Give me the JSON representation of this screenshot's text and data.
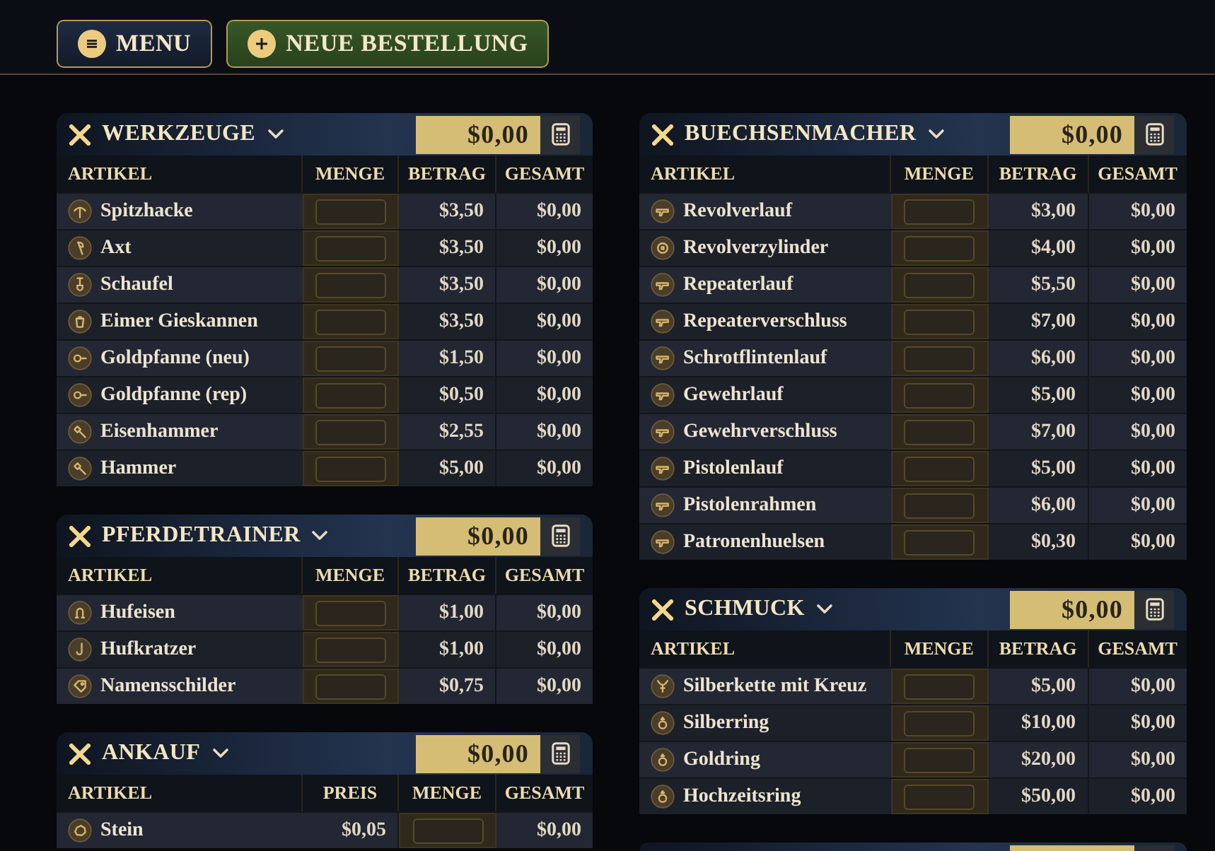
{
  "toolbar": {
    "buttons": [
      {
        "label": "MENU",
        "kind": "menu"
      },
      {
        "label": "NEUE BESTELLUNG",
        "kind": "new"
      }
    ]
  },
  "columns": [
    {
      "panels": [
        {
          "title": "WERKZEUGE",
          "expanded": true,
          "total": "$0,00",
          "columns": [
            {
              "label": "ARTIKEL",
              "kind": "item"
            },
            {
              "label": "MENGE",
              "kind": "quantity"
            },
            {
              "label": "BETRAG",
              "kind": "price"
            },
            {
              "label": "GESAMT",
              "kind": "total"
            }
          ],
          "rows": [
            {
              "item": "Spitzhacke",
              "price": "$3,50",
              "total": "$0,00"
            },
            {
              "item": "Axt",
              "price": "$3,50",
              "total": "$0,00"
            },
            {
              "item": "Schaufel",
              "price": "$3,50",
              "total": "$0,00"
            },
            {
              "item": "Eimer Gieskannen",
              "price": "$3,50",
              "total": "$0,00"
            },
            {
              "item": "Goldpfanne (neu)",
              "price": "$1,50",
              "total": "$0,00"
            },
            {
              "item": "Goldpfanne (rep)",
              "price": "$0,50",
              "total": "$0,00"
            },
            {
              "item": "Eisenhammer",
              "price": "$2,55",
              "total": "$0,00"
            },
            {
              "item": "Hammer",
              "price": "$5,00",
              "total": "$0,00"
            }
          ]
        },
        {
          "title": "PFERDETRAINER",
          "expanded": true,
          "total": "$0,00",
          "columns": [
            {
              "label": "ARTIKEL",
              "kind": "item"
            },
            {
              "label": "MENGE",
              "kind": "quantity"
            },
            {
              "label": "BETRAG",
              "kind": "price"
            },
            {
              "label": "GESAMT",
              "kind": "total"
            }
          ],
          "rows": [
            {
              "item": "Hufeisen",
              "price": "$1,00",
              "total": "$0,00"
            },
            {
              "item": "Hufkratzer",
              "price": "$1,00",
              "total": "$0,00"
            },
            {
              "item": "Namensschilder",
              "price": "$0,75",
              "total": "$0,00"
            }
          ]
        },
        {
          "title": "ANKAUF",
          "expanded": true,
          "total": "$0,00",
          "columns": [
            {
              "label": "ARTIKEL",
              "kind": "item"
            },
            {
              "label": "PREIS",
              "kind": "price"
            },
            {
              "label": "MENGE",
              "kind": "quantity"
            },
            {
              "label": "GESAMT",
              "kind": "total"
            }
          ],
          "rows": [
            {
              "item": "Stein",
              "price": "$0,05",
              "total": "$0,00"
            }
          ]
        }
      ]
    },
    {
      "panels": [
        {
          "title": "BUECHSENMACHER",
          "expanded": true,
          "total": "$0,00",
          "columns": [
            {
              "label": "ARTIKEL",
              "kind": "item"
            },
            {
              "label": "MENGE",
              "kind": "quantity"
            },
            {
              "label": "BETRAG",
              "kind": "price"
            },
            {
              "label": "GESAMT",
              "kind": "total"
            }
          ],
          "rows": [
            {
              "item": "Revolverlauf",
              "price": "$3,00",
              "total": "$0,00"
            },
            {
              "item": "Revolverzylinder",
              "price": "$4,00",
              "total": "$0,00"
            },
            {
              "item": "Repeaterlauf",
              "price": "$5,50",
              "total": "$0,00"
            },
            {
              "item": "Repeaterverschluss",
              "price": "$7,00",
              "total": "$0,00"
            },
            {
              "item": "Schrotflintenlauf",
              "price": "$6,00",
              "total": "$0,00"
            },
            {
              "item": "Gewehrlauf",
              "price": "$5,00",
              "total": "$0,00"
            },
            {
              "item": "Gewehrverschluss",
              "price": "$7,00",
              "total": "$0,00"
            },
            {
              "item": "Pistolenlauf",
              "price": "$5,00",
              "total": "$0,00"
            },
            {
              "item": "Pistolenrahmen",
              "price": "$6,00",
              "total": "$0,00"
            },
            {
              "item": "Patronenhuelsen",
              "price": "$0,30",
              "total": "$0,00"
            }
          ]
        },
        {
          "title": "SCHMUCK",
          "expanded": true,
          "total": "$0,00",
          "columns": [
            {
              "label": "ARTIKEL",
              "kind": "item"
            },
            {
              "label": "MENGE",
              "kind": "quantity"
            },
            {
              "label": "BETRAG",
              "kind": "price"
            },
            {
              "label": "GESAMT",
              "kind": "total"
            }
          ],
          "rows": [
            {
              "item": "Silberkette mit Kreuz",
              "price": "$5,00",
              "total": "$0,00"
            },
            {
              "item": "Silberring",
              "price": "$10,00",
              "total": "$0,00"
            },
            {
              "item": "Goldring",
              "price": "$20,00",
              "total": "$0,00"
            },
            {
              "item": "Hochzeitsring",
              "price": "$50,00",
              "total": "$0,00"
            }
          ]
        }
      ]
    }
  ]
}
